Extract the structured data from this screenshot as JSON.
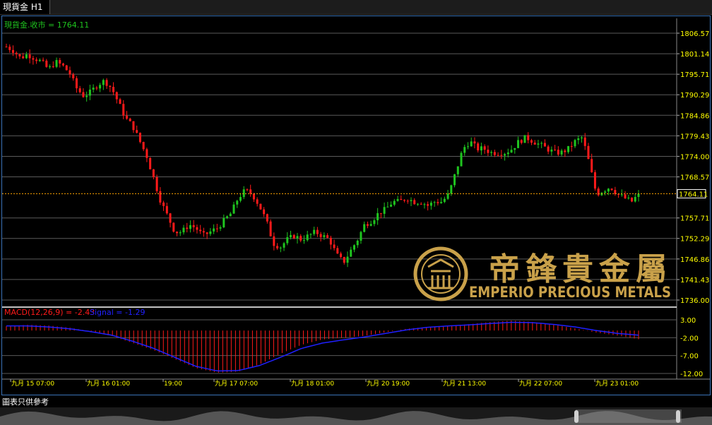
{
  "tab": {
    "title": "現貨金 H1"
  },
  "footer": {
    "disclaimer": "圖表只供參考"
  },
  "logo": {
    "chinese": "帝鋒貴金屬",
    "english": "EMPERIO PRECIOUS METALS"
  },
  "colors": {
    "up": "#1fc41f",
    "down": "#ff1a1a",
    "grid": "#5a5a5a",
    "axis_text": "#ffff00",
    "price_line": "#ffa500",
    "signal": "#2020ff",
    "frame": "#3a73b8",
    "logo_gold": "#c9a14a"
  },
  "chart_data": [
    {
      "type": "candlestick",
      "legend": "現貨金.收市 = 1764.11",
      "y_ticks": [
        "1806.57",
        "1801.14",
        "1795.71",
        "1790.29",
        "1784.86",
        "1779.43",
        "1774.00",
        "1768.57",
        "1757.71",
        "1752.29",
        "1746.86",
        "1741.43",
        "1736.00"
      ],
      "ylim": [
        1736.0,
        1806.57
      ],
      "current_price": 1764.11,
      "current_price_label": "1764.11",
      "x_ticks": [
        "九月 15 07:00",
        "九月 16 01:00",
        "19:00",
        "九月 17 07:00",
        "九月 18 01:00",
        "九月 20 19:00",
        "九月 21 13:00",
        "九月 22 07:00",
        "九月 23 01:00"
      ],
      "close_path": [
        1803,
        1802,
        1800,
        1801,
        1800,
        1799,
        1797,
        1799,
        1798,
        1796,
        1792,
        1790,
        1791,
        1793,
        1794,
        1792,
        1788,
        1784,
        1782,
        1778,
        1774,
        1768,
        1762,
        1758,
        1754,
        1754,
        1756,
        1755,
        1753,
        1754,
        1755,
        1757,
        1759,
        1763,
        1765,
        1764,
        1761,
        1757,
        1751,
        1750,
        1752,
        1753,
        1752,
        1753,
        1754,
        1753,
        1752,
        1748,
        1746,
        1749,
        1752,
        1756,
        1757,
        1759,
        1760,
        1762,
        1762,
        1763,
        1762,
        1762,
        1761,
        1762,
        1762,
        1764,
        1770,
        1776,
        1778,
        1776,
        1776,
        1775,
        1775,
        1775,
        1776,
        1778,
        1779,
        1778,
        1777,
        1776,
        1775,
        1775,
        1776,
        1778,
        1779,
        1772,
        1764,
        1765,
        1766,
        1764,
        1763,
        1762,
        1764
      ]
    },
    {
      "type": "bar+line",
      "legend_macd": "MACD(12,26,9) = -2.43",
      "legend_signal": "Signal = -1.29",
      "y_ticks": [
        "3.00",
        "-2.00",
        "-7.00",
        "-12.00"
      ],
      "ylim": [
        -12.0,
        3.0
      ],
      "macd_path": [
        1.2,
        1.6,
        1.4,
        0.8,
        -0.2,
        -1.5,
        -3.5,
        -5.5,
        -8.0,
        -10.5,
        -11.8,
        -11.5,
        -9.5,
        -6.5,
        -4.0,
        -2.5,
        -2.0,
        -1.5,
        -0.5,
        0.5,
        1.0,
        1.4,
        1.8,
        2.4,
        2.8,
        2.4,
        1.6,
        0.6,
        -0.6,
        -1.4,
        -2.43
      ],
      "signal_path": [
        1.3,
        1.3,
        1.0,
        0.5,
        -0.3,
        -1.3,
        -3.0,
        -5.0,
        -7.5,
        -10.0,
        -11.3,
        -11.2,
        -9.8,
        -7.5,
        -5.0,
        -3.5,
        -2.6,
        -1.8,
        -0.8,
        0.2,
        0.9,
        1.3,
        1.6,
        2.0,
        2.3,
        2.2,
        1.7,
        1.0,
        0.0,
        -0.8,
        -1.29
      ]
    }
  ]
}
